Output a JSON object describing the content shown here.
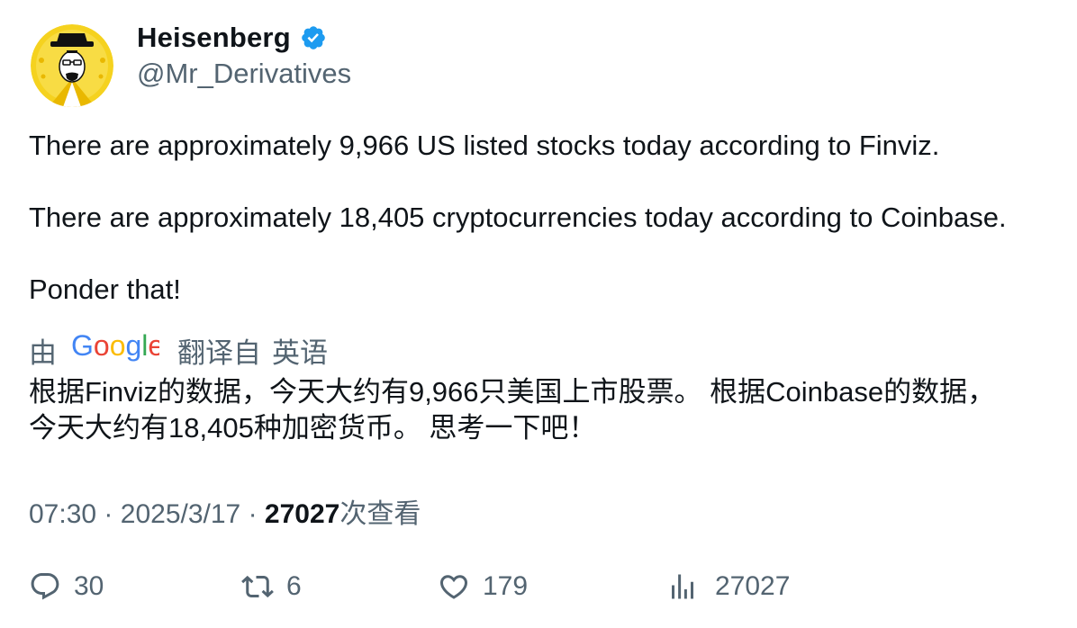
{
  "author": {
    "display_name": "Heisenberg",
    "handle": "@Mr_Derivatives",
    "verified": true,
    "avatar_icon": "heisenberg-avatar-icon",
    "avatar_bg": "#f5d21f"
  },
  "tweet": {
    "lines": [
      "There are approximately 9,966 US listed stocks today according to Finviz.",
      "There are approximately 18,405 cryptocurrencies today according to Coinbase.",
      "Ponder that!"
    ],
    "translation": {
      "by_label": "由",
      "provider": "Google",
      "from_label": "翻译自",
      "language": "英语",
      "lines": [
        "根据Finviz的数据，今天大约有9,966只美国上市股票。 根据Coinbase的数据，",
        "今天大约有18,405种加密货币。 思考一下吧！"
      ]
    }
  },
  "meta": {
    "time": "07:30",
    "separator": "·",
    "date": "2025/3/17",
    "views_count": "27027",
    "views_label": "次查看"
  },
  "actions": {
    "reply": {
      "icon": "reply-icon",
      "count": "30"
    },
    "retweet": {
      "icon": "retweet-icon",
      "count": "6"
    },
    "like": {
      "icon": "heart-icon",
      "count": "179"
    },
    "views": {
      "icon": "analytics-icon",
      "count": "27027"
    }
  },
  "colors": {
    "text": "#0f1419",
    "secondary": "#536471",
    "verified": "#1d9bf0"
  }
}
